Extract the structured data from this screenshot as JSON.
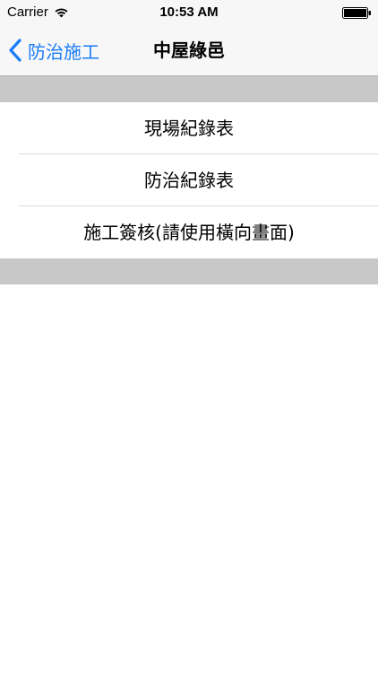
{
  "status_bar": {
    "carrier": "Carrier",
    "time": "10:53 AM",
    "wifi_icon": "wifi-icon",
    "battery_icon": "battery-icon"
  },
  "nav_bar": {
    "back_label": "防治施工",
    "back_icon": "chevron-left-icon",
    "title": "中屋綠邑",
    "accent_color": "#1a7cf9"
  },
  "menu": {
    "items": [
      {
        "label": "現場紀錄表"
      },
      {
        "label": "防治紀錄表"
      },
      {
        "label": "施工簽核(請使用橫向畫面)"
      }
    ]
  },
  "colors": {
    "bar_background": "#f7f7f7",
    "section_gray": "#c8c8c8",
    "separator": "#d9d9d9"
  }
}
